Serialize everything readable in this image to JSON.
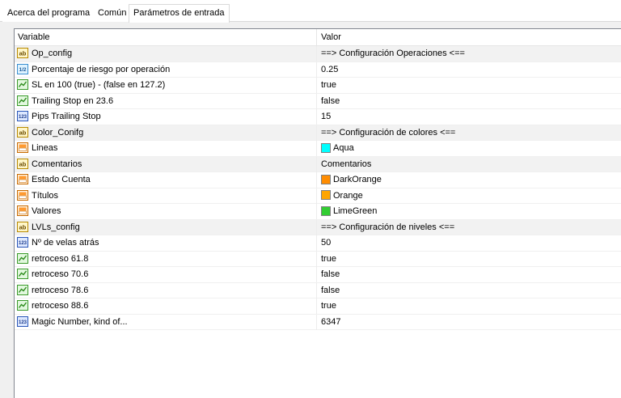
{
  "tabs": [
    {
      "label": "Acerca del programa",
      "active": false
    },
    {
      "label": "Común",
      "active": false
    },
    {
      "label": "Parámetros de entrada",
      "active": true
    }
  ],
  "table": {
    "headers": {
      "variable": "Variable",
      "value": "Valor"
    },
    "rows": [
      {
        "icon": "string-icon",
        "name": "Op_config",
        "value": "==> Configuración Operaciones <==",
        "group": true
      },
      {
        "icon": "double-icon",
        "name": "Porcentaje de riesgo por operación",
        "value": "0.25"
      },
      {
        "icon": "bool-icon",
        "name": "SL en 100 (true) - (false en 127.2)",
        "value": "true"
      },
      {
        "icon": "bool-icon",
        "name": "Trailing Stop en 23.6",
        "value": "false"
      },
      {
        "icon": "int-icon",
        "name": "Pips Trailing Stop",
        "value": "15"
      },
      {
        "icon": "string-icon",
        "name": "Color_Conifg",
        "value": "==> Configuración de colores <==",
        "group": true
      },
      {
        "icon": "color-icon",
        "name": "Lineas",
        "value": "Aqua",
        "swatch": "#00ffff"
      },
      {
        "icon": "string-icon",
        "name": "Comentarios",
        "value": "Comentarios",
        "group": true
      },
      {
        "icon": "color-icon",
        "name": "Estado Cuenta",
        "value": "DarkOrange",
        "swatch": "#ff8c00"
      },
      {
        "icon": "color-icon",
        "name": "Títulos",
        "value": "Orange",
        "swatch": "#ffa500"
      },
      {
        "icon": "color-icon",
        "name": "Valores",
        "value": "LimeGreen",
        "swatch": "#32cd32"
      },
      {
        "icon": "string-icon",
        "name": "LVLs_config",
        "value": "==> Configuración de niveles <==",
        "group": true
      },
      {
        "icon": "int-icon",
        "name": "Nº de velas atrás",
        "value": "50"
      },
      {
        "icon": "bool-icon",
        "name": "retroceso 61.8",
        "value": "true"
      },
      {
        "icon": "bool-icon",
        "name": "retroceso 70.6",
        "value": "false"
      },
      {
        "icon": "bool-icon",
        "name": "retroceso 78.6",
        "value": "false"
      },
      {
        "icon": "bool-icon",
        "name": "retroceso 88.6",
        "value": "true"
      },
      {
        "icon": "int-icon",
        "name": "Magic Number, kind of...",
        "value": "6347"
      }
    ]
  }
}
